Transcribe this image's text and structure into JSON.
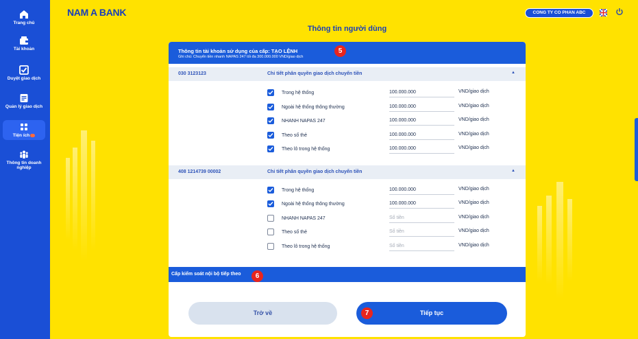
{
  "brand": {
    "logo_text": "NAM A BANK",
    "primary_color": "#1a4fd6",
    "accent_color": "#ffe200",
    "alert_color": "#e8251e"
  },
  "header": {
    "company": "CONG TY CO PHAN ABC",
    "flag_icon": "uk-flag-icon",
    "power_icon": "power-icon"
  },
  "sidebar": {
    "items": [
      {
        "label": "Trang chủ",
        "icon": "home-icon"
      },
      {
        "label": "Tài khoản",
        "icon": "wallet-icon"
      },
      {
        "label": "Duyệt giao dịch",
        "icon": "check-square-icon"
      },
      {
        "label": "Quản lý giao dịch",
        "icon": "document-icon"
      },
      {
        "label": "Tiện ích",
        "icon": "grid-icon",
        "active": true,
        "badge": "new"
      },
      {
        "label_line1": "Thông tin doanh",
        "label_line2": "nghiệp",
        "icon": "users-icon"
      }
    ]
  },
  "page": {
    "title": "Thông tin người dùng"
  },
  "info": {
    "title": "Thông tin tài khoản sử dụng của cấp: TẠO LỆNH",
    "note": "Ghi chú: Chuyển tiền nhanh NAPAS 247 tối đa 300.000.000 VND/giao dịch",
    "step_badge": "5"
  },
  "accounts": [
    {
      "number": "030 3123123",
      "detail_label": "Chi tiết phân quyền giao dịch chuyển tiền",
      "rows": [
        {
          "label": "Trong hệ thống",
          "checked": true,
          "amount": "100.000.000",
          "unit": "VND/giao dịch"
        },
        {
          "label": "Ngoài hệ thống thông thường",
          "checked": true,
          "amount": "100.000.000",
          "unit": "VND/giao dịch"
        },
        {
          "label": "NHANH NAPAS 247",
          "checked": true,
          "amount": "100.000.000",
          "unit": "VND/giao dịch"
        },
        {
          "label": "Theo số thẻ",
          "checked": true,
          "amount": "100.000.000",
          "unit": "VND/giao dịch"
        },
        {
          "label": "Theo lô trong hệ thống",
          "checked": true,
          "amount": "100.000.000",
          "unit": "VND/giao dịch"
        }
      ]
    },
    {
      "number": "408 1214739 00002",
      "detail_label": "Chi tiết phân quyền giao dịch chuyển tiền",
      "rows": [
        {
          "label": "Trong hệ thống",
          "checked": true,
          "amount": "100.000.000",
          "unit": "VND/giao dịch"
        },
        {
          "label": "Ngoài hệ thống thông thường",
          "checked": true,
          "amount": "100.000.000",
          "unit": "VND/giao dịch"
        },
        {
          "label": "NHANH NAPAS 247",
          "checked": false,
          "placeholder": "Số tiền",
          "unit": "VND/giao dịch"
        },
        {
          "label": "Theo số thẻ",
          "checked": false,
          "placeholder": "Số tiền",
          "unit": "VND/giao dịch"
        },
        {
          "label": "Theo lô trong hệ thống",
          "checked": false,
          "placeholder": "Số tiền",
          "unit": "VND/giao dịch"
        }
      ]
    }
  ],
  "next_level": {
    "label": "Cấp kiểm soát nội bộ tiếp theo",
    "step_badge": "6"
  },
  "actions": {
    "back": "Trở về",
    "next": "Tiếp tục",
    "next_badge": "7"
  }
}
